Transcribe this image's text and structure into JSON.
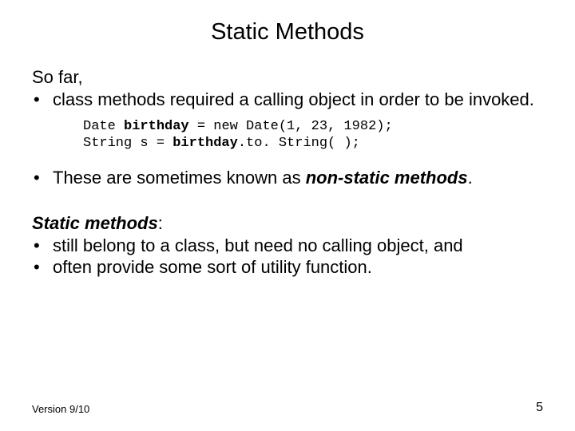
{
  "title": "Static Methods",
  "section1": {
    "intro": "So far,",
    "bullet": "class methods required a calling object in order to be invoked."
  },
  "code": {
    "line1": {
      "p1": "Date ",
      "p2": "birthday",
      "p3": " = new Date(1, 23, 1982);"
    },
    "line2": {
      "p1": "String s = ",
      "p2": "birthday",
      "p3": ".to. String( );"
    }
  },
  "section2": {
    "prefix": "These are sometimes known as ",
    "strong": "non-static methods",
    "suffix": "."
  },
  "section3": {
    "heading_strong": "Static methods",
    "heading_suffix": ":",
    "bullets": [
      "still belong to a class, but need no calling object, and",
      "often provide some sort of utility function."
    ]
  },
  "footer": {
    "version": "Version 9/10",
    "page": "5"
  },
  "bullet_char": "•"
}
